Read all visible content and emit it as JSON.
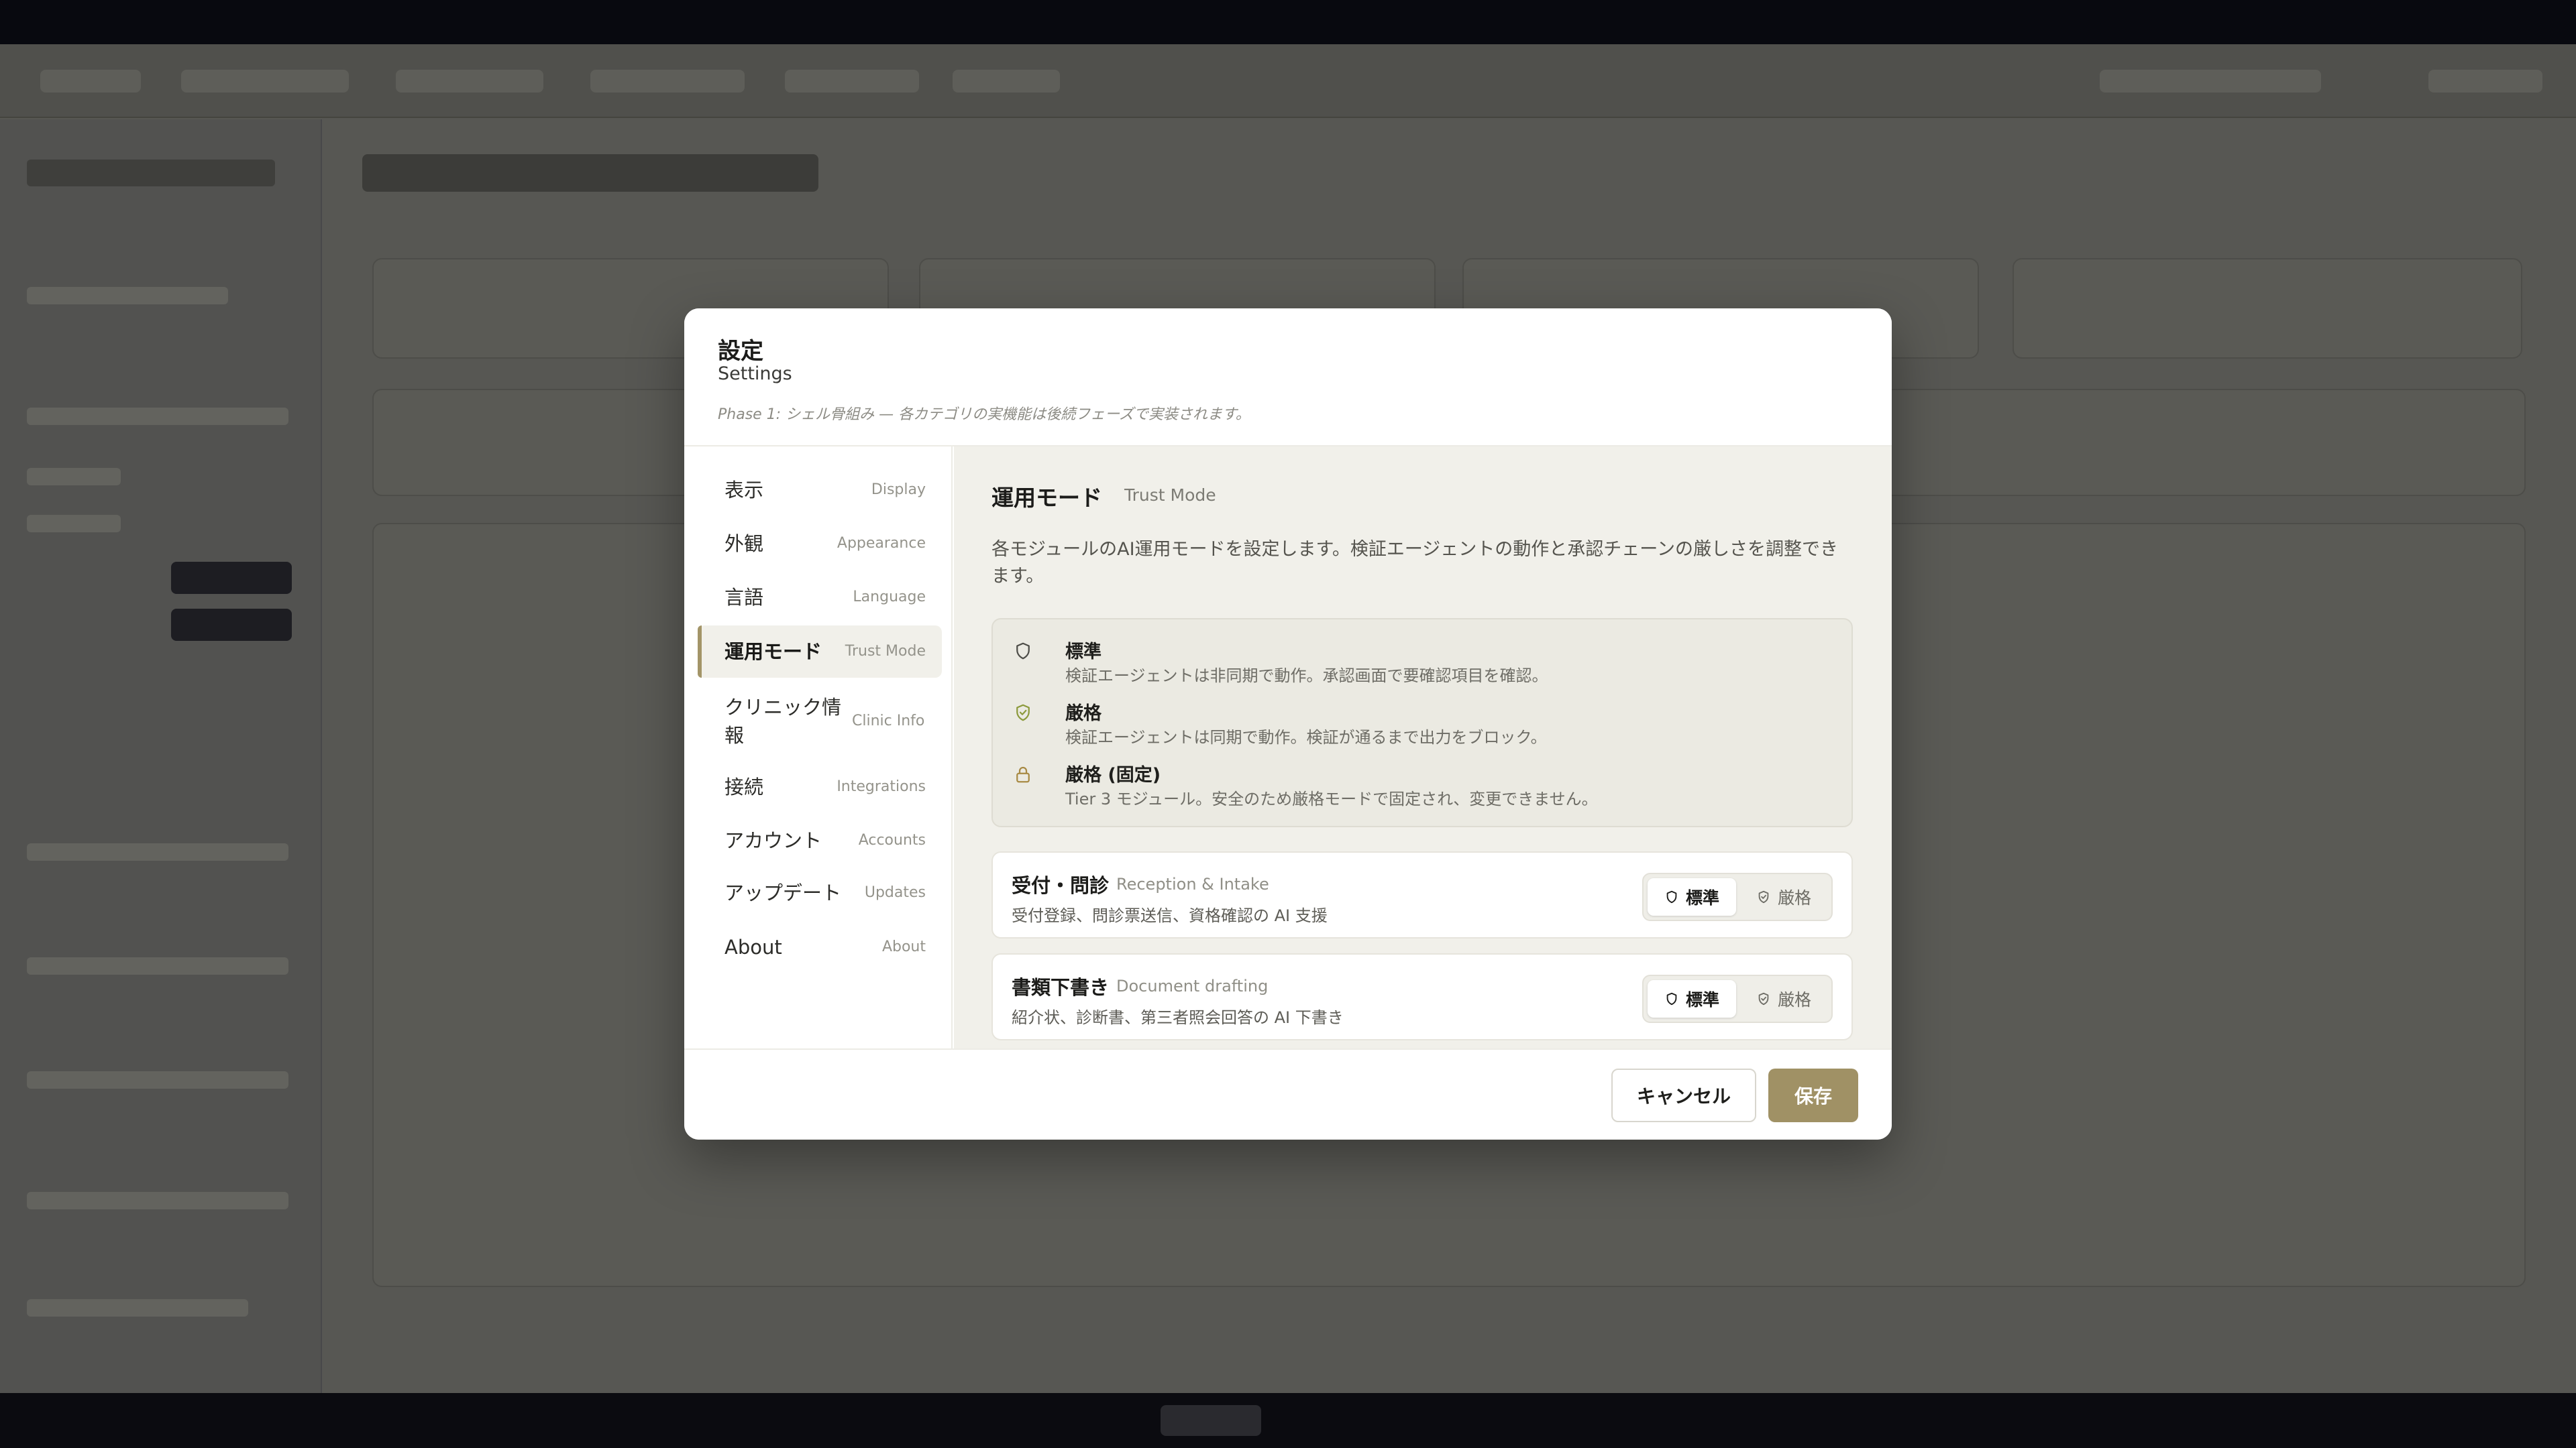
{
  "dialog": {
    "title": "設定",
    "subtitle": "Settings",
    "phase_note": "Phase 1: シェル骨組み — 各カテゴリの実機能は後続フェーズで実装されます。"
  },
  "nav": {
    "items": [
      {
        "ja": "表示",
        "en": "Display",
        "active": false
      },
      {
        "ja": "外観",
        "en": "Appearance",
        "active": false
      },
      {
        "ja": "言語",
        "en": "Language",
        "active": false
      },
      {
        "ja": "運用モード",
        "en": "Trust Mode",
        "active": true
      },
      {
        "ja": "クリニック情報",
        "en": "Clinic Info",
        "active": false
      },
      {
        "ja": "接続",
        "en": "Integrations",
        "active": false
      },
      {
        "ja": "アカウント",
        "en": "Accounts",
        "active": false
      },
      {
        "ja": "アップデート",
        "en": "Updates",
        "active": false
      },
      {
        "ja": "About",
        "en": "About",
        "active": false
      }
    ]
  },
  "section": {
    "title": "運用モード",
    "subtitle": "Trust Mode",
    "description": "各モジュールのAI運用モードを設定します。検証エージェントの動作と承認チェーンの厳しさを調整できます。"
  },
  "legend": [
    {
      "icon": "shield-icon",
      "name": "標準",
      "desc": "検証エージェントは非同期で動作。承認画面で要確認項目を確認。"
    },
    {
      "icon": "shield-check-icon",
      "name": "厳格",
      "desc": "検証エージェントは同期で動作。検証が通るまで出力をブロック。"
    },
    {
      "icon": "lock-icon",
      "name": "厳格 (固定)",
      "desc": "Tier 3 モジュール。安全のため厳格モードで固定され、変更できません。"
    }
  ],
  "modules": [
    {
      "name": "受付・問診",
      "en": "Reception & Intake",
      "desc": "受付登録、問診票送信、資格確認の AI 支援",
      "mode": "標準",
      "std_label": "標準",
      "strict_label": "厳格"
    },
    {
      "name": "書類下書き",
      "en": "Document drafting",
      "desc": "紹介状、診断書、第三者照会回答の AI 下書き",
      "mode": "標準",
      "std_label": "標準",
      "strict_label": "厳格"
    }
  ],
  "footer": {
    "cancel_label": "キャンセル",
    "save_label": "保存"
  },
  "colors": {
    "accent": "#a09165",
    "content_bg": "#f1f0ea",
    "check_green": "#8c9a3c",
    "lock_gold": "#a88a44"
  }
}
